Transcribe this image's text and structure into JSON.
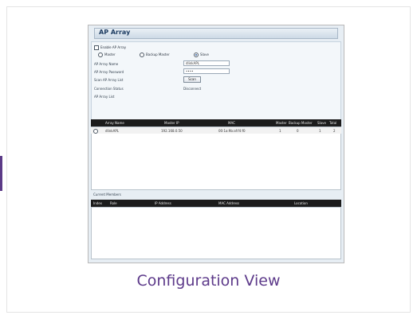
{
  "window": {
    "title": "AP Array"
  },
  "form": {
    "enable_label": "Enable AP Array",
    "modes": [
      {
        "label": "Master",
        "selected": false
      },
      {
        "label": "Backup Master",
        "selected": false
      },
      {
        "label": "Slave",
        "selected": true
      }
    ],
    "array_name_label": "AP Array Name",
    "array_name_value": "dlinkAPL",
    "array_password_label": "AP Array Password",
    "array_password_value": "••••",
    "scan_list_label": "Scan AP Array List",
    "scan_button": "Scan",
    "connection_status_label": "Connection Status",
    "connection_status_value": "Disconnect",
    "array_list_label": "AP Array List"
  },
  "array_table": {
    "columns": [
      "Array Name",
      "Master IP",
      "MAC",
      "Master",
      "Backup Master",
      "Slave",
      "Total"
    ],
    "rows": [
      [
        "dlinkAPL",
        "192.168.0.50",
        "00:1a:9b:af:f4:f0",
        "1",
        "0",
        "1",
        "2"
      ]
    ]
  },
  "members": {
    "label": "Current Members",
    "columns": [
      "Index",
      "Role",
      "IP Address",
      "MAC Address",
      "Location"
    ]
  },
  "caption": "Configuration View"
}
